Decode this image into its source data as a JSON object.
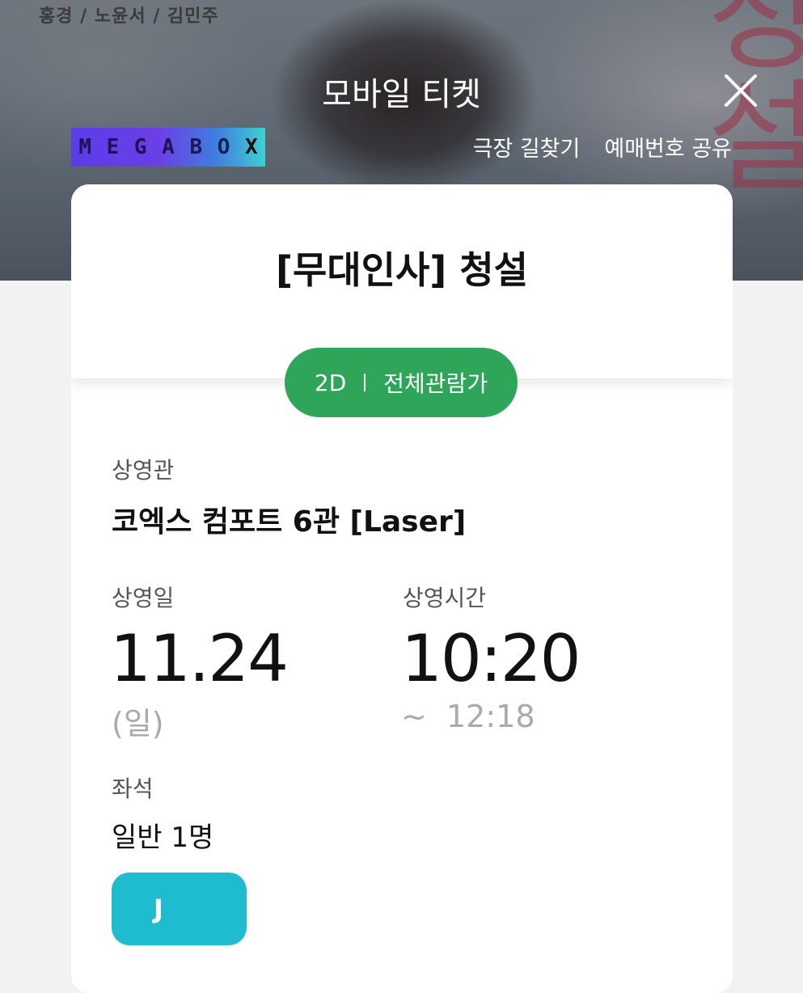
{
  "poster": {
    "credits": "홍경 / 노윤서 / 김민주",
    "title_art": "청설"
  },
  "header": {
    "title": "모바일 티켓",
    "close_icon": "close-icon",
    "logo_letters": [
      "M",
      "E",
      "G",
      "A",
      "B",
      "O",
      "X"
    ],
    "links": {
      "directions": "극장 길찾기",
      "share_booking": "예매번호 공유"
    }
  },
  "ticket": {
    "movie_title": "[무대인사] 청설",
    "format": "2D",
    "rating": "전체관람가",
    "theater_label": "상영관",
    "theater_value": "코엑스 컴포트 6관 [Laser]",
    "date_label": "상영일",
    "date_value": "11.24",
    "day_value": "(일)",
    "time_label": "상영시간",
    "time_start": "10:20",
    "time_end": "~  12:18",
    "seat_label": "좌석",
    "seat_value": "일반 1명",
    "seat_chip": "J"
  },
  "colors": {
    "pill_green": "#2fa55a",
    "seat_chip": "#1fbcd0"
  }
}
